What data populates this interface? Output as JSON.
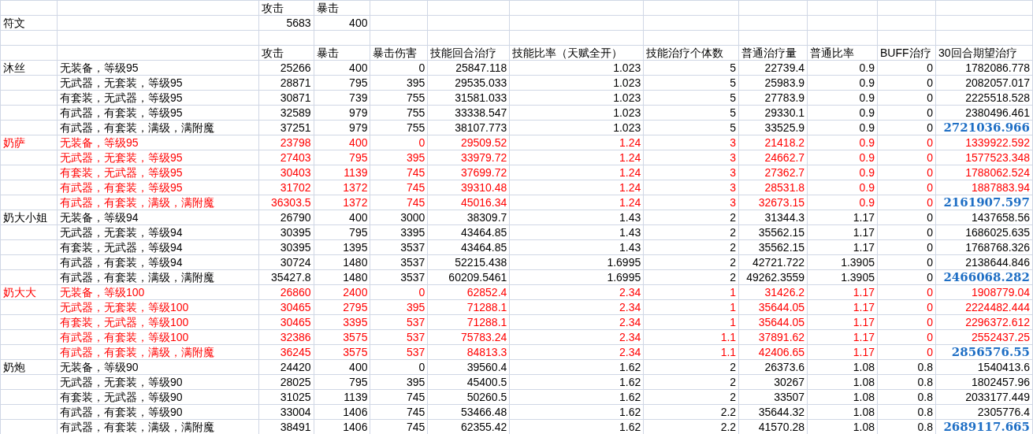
{
  "top_headers": [
    "攻击",
    "暴击"
  ],
  "rune": {
    "label": "符文",
    "values": [
      "5683",
      "400"
    ]
  },
  "columns": [
    "攻击",
    "暴击",
    "暴击伤害",
    "技能回合治疗",
    "技能比率（天赋全开）",
    "技能治疗个体数",
    "普通治疗量",
    "普通比率",
    "BUFF治疗",
    "30回合期望治疗"
  ],
  "groups": [
    {
      "name": "沐丝",
      "red": false,
      "rows": [
        {
          "label": "无装备，等级95",
          "values": [
            "25266",
            "400",
            "0",
            "25847.118",
            "1.023",
            "5",
            "22739.4",
            "0.9",
            "0",
            "1782086.778"
          ],
          "highlight": false
        },
        {
          "label": "无武器，无套装，等级95",
          "values": [
            "28871",
            "795",
            "395",
            "29535.033",
            "1.023",
            "5",
            "25983.9",
            "0.9",
            "0",
            "2082057.017"
          ],
          "highlight": false
        },
        {
          "label": "有套装，无武器，等级95",
          "values": [
            "30871",
            "739",
            "755",
            "31581.033",
            "1.023",
            "5",
            "27783.9",
            "0.9",
            "0",
            "2225518.528"
          ],
          "highlight": false
        },
        {
          "label": "有武器，有套装，等级95",
          "values": [
            "32589",
            "979",
            "755",
            "33338.547",
            "1.023",
            "5",
            "29330.1",
            "0.9",
            "0",
            "2380496.461"
          ],
          "highlight": false
        },
        {
          "label": "有武器，有套装，满级，满附魔",
          "values": [
            "37251",
            "979",
            "755",
            "38107.773",
            "1.023",
            "5",
            "33525.9",
            "0.9",
            "0",
            "2721036.966"
          ],
          "highlight": true
        }
      ]
    },
    {
      "name": "奶萨",
      "red": true,
      "rows": [
        {
          "label": "无装备，等级95",
          "values": [
            "23798",
            "400",
            "0",
            "29509.52",
            "1.24",
            "3",
            "21418.2",
            "0.9",
            "0",
            "1339922.592"
          ],
          "highlight": false
        },
        {
          "label": "无武器，无套装，等级95",
          "values": [
            "27403",
            "795",
            "395",
            "33979.72",
            "1.24",
            "3",
            "24662.7",
            "0.9",
            "0",
            "1577523.348"
          ],
          "highlight": false
        },
        {
          "label": "有套装，无武器，等级95",
          "values": [
            "30403",
            "1139",
            "745",
            "37699.72",
            "1.24",
            "3",
            "27362.7",
            "0.9",
            "0",
            "1788062.524"
          ],
          "highlight": false
        },
        {
          "label": "有武器，有套装，等级95",
          "values": [
            "31702",
            "1372",
            "745",
            "39310.48",
            "1.24",
            "3",
            "28531.8",
            "0.9",
            "0",
            "1887883.94"
          ],
          "highlight": false
        },
        {
          "label": "有武器，有套装，满级，满附魔",
          "values": [
            "36303.5",
            "1372",
            "745",
            "45016.34",
            "1.24",
            "3",
            "32673.15",
            "0.9",
            "0",
            "2161907.597"
          ],
          "highlight": true
        }
      ]
    },
    {
      "name": "奶大小姐",
      "red": false,
      "rows": [
        {
          "label": "无装备，等级94",
          "values": [
            "26790",
            "400",
            "3000",
            "38309.7",
            "1.43",
            "2",
            "31344.3",
            "1.17",
            "0",
            "1437658.56"
          ],
          "highlight": false
        },
        {
          "label": "无武器，无套装，等级94",
          "values": [
            "30395",
            "795",
            "3395",
            "43464.85",
            "1.43",
            "2",
            "35562.15",
            "1.17",
            "0",
            "1686025.635"
          ],
          "highlight": false
        },
        {
          "label": "有套装，无武器，等级94",
          "values": [
            "30395",
            "1395",
            "3537",
            "43464.85",
            "1.43",
            "2",
            "35562.15",
            "1.17",
            "0",
            "1768768.326"
          ],
          "highlight": false
        },
        {
          "label": "有武器，有套装，等级94",
          "values": [
            "30724",
            "1480",
            "3537",
            "52215.438",
            "1.6995",
            "2",
            "42721.722",
            "1.3905",
            "0",
            "2138644.846"
          ],
          "highlight": false
        },
        {
          "label": "有武器，有套装，满级，满附魔",
          "values": [
            "35427.8",
            "1480",
            "3537",
            "60209.5461",
            "1.6995",
            "2",
            "49262.3559",
            "1.3905",
            "0",
            "2466068.282"
          ],
          "highlight": true
        }
      ]
    },
    {
      "name": "奶大大",
      "red": true,
      "rows": [
        {
          "label": "无装备，等级100",
          "values": [
            "26860",
            "2400",
            "0",
            "62852.4",
            "2.34",
            "1",
            "31426.2",
            "1.17",
            "0",
            "1908779.04"
          ],
          "highlight": false
        },
        {
          "label": "无武器，无套装，等级100",
          "values": [
            "30465",
            "2795",
            "395",
            "71288.1",
            "2.34",
            "1",
            "35644.05",
            "1.17",
            "0",
            "2224482.444"
          ],
          "highlight": false
        },
        {
          "label": "有套装，无武器，等级100",
          "values": [
            "30465",
            "3395",
            "537",
            "71288.1",
            "2.34",
            "1",
            "35644.05",
            "1.17",
            "0",
            "2296372.612"
          ],
          "highlight": false
        },
        {
          "label": "有武器，有套装，等级100",
          "values": [
            "32386",
            "3575",
            "537",
            "75783.24",
            "2.34",
            "1.1",
            "37891.62",
            "1.17",
            "0",
            "2552437.25"
          ],
          "highlight": false
        },
        {
          "label": "有武器，有套装，满级，满附魔",
          "values": [
            "36245",
            "3575",
            "537",
            "84813.3",
            "2.34",
            "1.1",
            "42406.65",
            "1.17",
            "0",
            "2856576.55"
          ],
          "highlight": true
        }
      ]
    },
    {
      "name": "奶炮",
      "red": false,
      "rows": [
        {
          "label": "无装备，等级90",
          "values": [
            "24420",
            "400",
            "0",
            "39560.4",
            "1.62",
            "2",
            "26373.6",
            "1.08",
            "0.8",
            "1540413.6"
          ],
          "highlight": false
        },
        {
          "label": "无武器，无套装，等级90",
          "values": [
            "28025",
            "795",
            "395",
            "45400.5",
            "1.62",
            "2",
            "30267",
            "1.08",
            "0.8",
            "1802457.96"
          ],
          "highlight": false
        },
        {
          "label": "有套装，无武器，等级90",
          "values": [
            "31025",
            "1139",
            "745",
            "50260.5",
            "1.62",
            "2",
            "33507",
            "1.08",
            "0.8",
            "2033177.449"
          ],
          "highlight": false
        },
        {
          "label": "有武器，有套装，等级90",
          "values": [
            "33004",
            "1406",
            "745",
            "53466.48",
            "1.62",
            "2.2",
            "35644.32",
            "1.08",
            "0.8",
            "2305776.4"
          ],
          "highlight": false
        },
        {
          "label": "有武器，有套装，满级，满附魔",
          "values": [
            "38491",
            "1406",
            "745",
            "62355.42",
            "1.62",
            "2.2",
            "41570.28",
            "1.08",
            "0.8",
            "2689117.665"
          ],
          "highlight": true
        }
      ]
    }
  ]
}
